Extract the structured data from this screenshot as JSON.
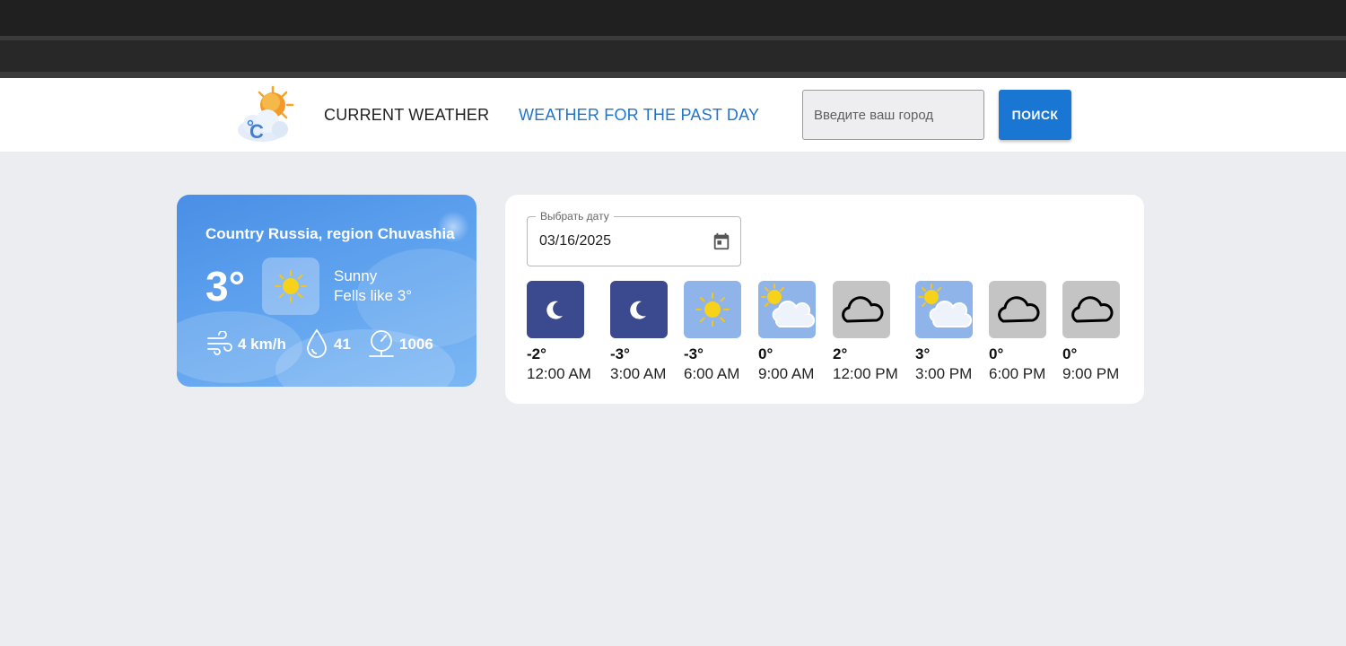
{
  "nav": {
    "current_label": "CURRENT WEATHER",
    "past_label": "WEATHER FOR THE PAST DAY"
  },
  "search": {
    "placeholder": "Введите ваш город",
    "button_label": "ПОИСК"
  },
  "current": {
    "location": "Country Russia, region Chuvashia",
    "temperature": "3°",
    "condition": "Sunny",
    "feels_like": "Fells like 3°",
    "wind": "4 km/h",
    "humidity": "41",
    "pressure": "1006",
    "condition_icon": "sun-icon"
  },
  "past": {
    "date_label": "Выбрать дату",
    "date_value": "03/16/2025",
    "hours": [
      {
        "temp": "-2°",
        "time": "12:00 AM",
        "icon": "moon-icon",
        "bg": "#3b4a8e"
      },
      {
        "temp": "-3°",
        "time": "3:00 AM",
        "icon": "moon-icon",
        "bg": "#3b4a8e"
      },
      {
        "temp": "-3°",
        "time": "6:00 AM",
        "icon": "sun-icon",
        "bg": "#8fb4ea"
      },
      {
        "temp": "0°",
        "time": "9:00 AM",
        "icon": "partly-cloudy-icon",
        "bg": "#8fb4ea"
      },
      {
        "temp": "2°",
        "time": "12:00 PM",
        "icon": "cloud-icon",
        "bg": "#c4c4c4"
      },
      {
        "temp": "3°",
        "time": "3:00 PM",
        "icon": "partly-cloudy-icon",
        "bg": "#8fb4ea"
      },
      {
        "temp": "0°",
        "time": "6:00 PM",
        "icon": "cloud-icon",
        "bg": "#c4c4c4"
      },
      {
        "temp": "0°",
        "time": "9:00 PM",
        "icon": "cloud-icon",
        "bg": "#c4c4c4"
      }
    ]
  },
  "colors": {
    "accent": "#1976d2",
    "nav_active": "#1e76d0",
    "night_bg": "#3b4a8e",
    "day_bg": "#8fb4ea",
    "cloudy_bg": "#c4c4c4"
  }
}
